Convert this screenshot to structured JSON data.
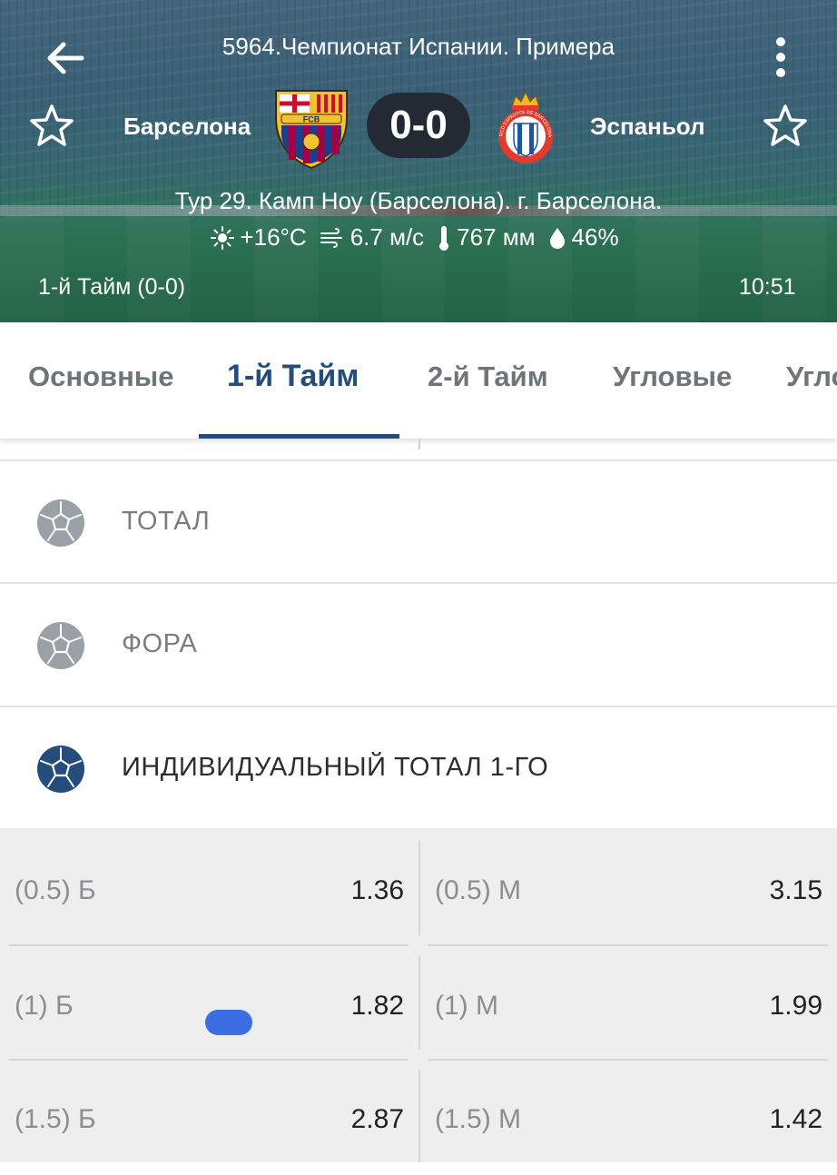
{
  "header": {
    "league": "5964.Чемпионат Испании. Примера",
    "home_team": "Барселона",
    "away_team": "Эспаньол",
    "home_crest_text": "FCB",
    "away_crest_text": "RCD ESPANYOL DE BARCELONA",
    "score": "0-0",
    "venue": "Тур 29. Камп Ноу (Барселона). г. Барселона.",
    "weather": {
      "temperature": "+16°C",
      "wind": "6.7 м/с",
      "pressure": "767 мм",
      "humidity": "46%"
    },
    "period": "1-й  Тайм (0-0)",
    "clock": "10:51",
    "icons": [
      "back-arrow-icon",
      "more-vert-icon",
      "star-outline-icon",
      "sun-icon",
      "wind-icon",
      "thermometer-icon",
      "drop-icon"
    ]
  },
  "tabs": {
    "items": [
      "Основные",
      "1-й  Тайм",
      "2-й  Тайм",
      "Угловые",
      "Угловые"
    ],
    "active_index": 1,
    "active_color": "#244d7c"
  },
  "groups": [
    {
      "title": "ТОТАЛ",
      "expanded": false
    },
    {
      "title": "ФОРА",
      "expanded": false
    },
    {
      "title": "ИНДИВИДУАЛЬНЫЙ ТОТАЛ 1-ГО",
      "expanded": true
    }
  ],
  "odds": [
    {
      "left_label": "(0.5) Б",
      "left_value": "1.36",
      "right_label": "(0.5) М",
      "right_value": "3.15"
    },
    {
      "left_label": "(1) Б",
      "left_value": "1.82",
      "right_label": "(1) М",
      "right_value": "1.99"
    },
    {
      "left_label": "(1.5) Б",
      "left_value": "2.87",
      "right_label": "(1.5) М",
      "right_value": "1.42"
    }
  ]
}
